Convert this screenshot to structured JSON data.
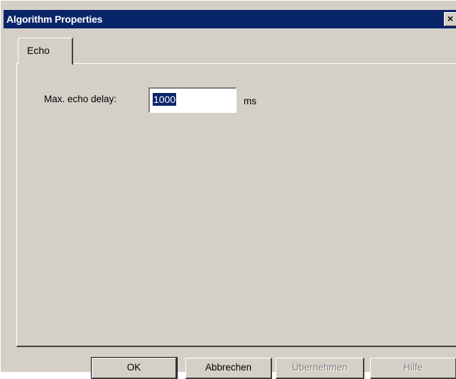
{
  "window": {
    "title": "Algorithm Properties",
    "close_glyph": "✕"
  },
  "tabs": [
    {
      "label": "Echo",
      "selected": true
    }
  ],
  "echo": {
    "delay_label": "Max. echo delay:",
    "delay_value": "1000",
    "delay_unit": "ms"
  },
  "buttons": {
    "ok": "OK",
    "cancel": "Abbrechen",
    "apply": "Übernehmen",
    "help": "Hilfe"
  },
  "colors": {
    "titlebar": "#0a246a",
    "face": "#d4d0c8",
    "selection": "#0a246a"
  }
}
